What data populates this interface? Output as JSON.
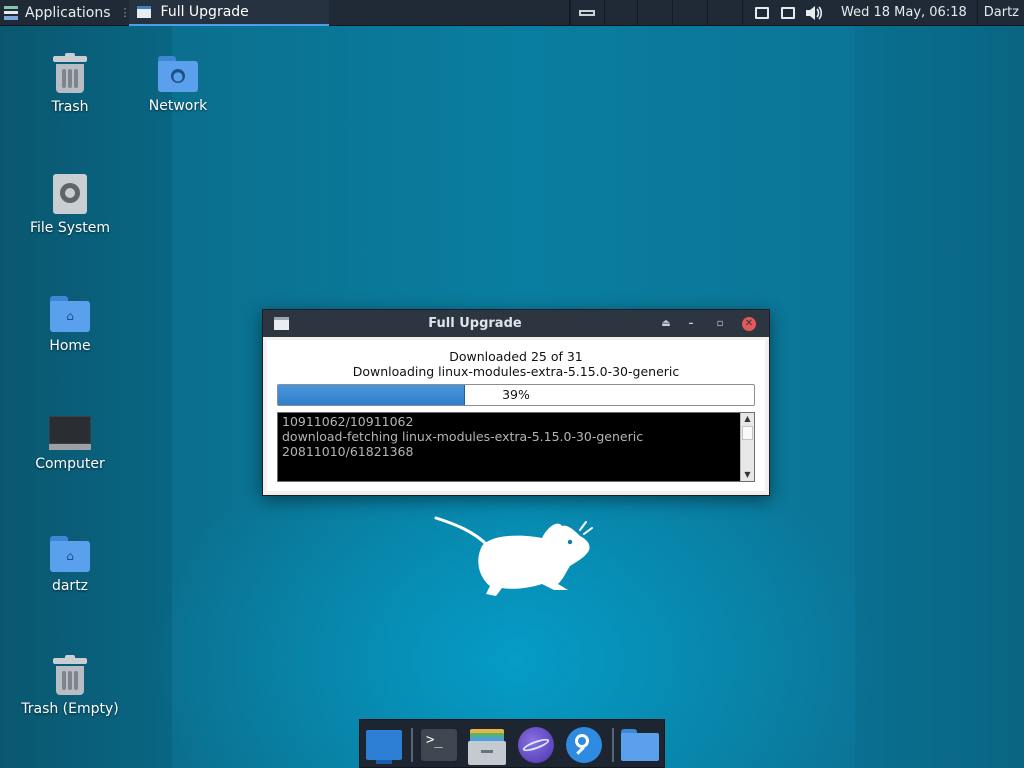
{
  "top_panel": {
    "applications_label": "Applications",
    "active_window_label": "Full Upgrade",
    "clock": "Wed 18 May, 06:18",
    "user": "Dartz"
  },
  "desktop_icons": [
    {
      "label": "Trash",
      "icon": "trash-icon"
    },
    {
      "label": "Network",
      "icon": "network-folder-icon"
    },
    {
      "label": "File System",
      "icon": "filesystem-icon"
    },
    {
      "label": "Home",
      "icon": "home-folder-icon"
    },
    {
      "label": "Computer",
      "icon": "computer-icon"
    },
    {
      "label": "dartz",
      "icon": "user-folder-icon"
    },
    {
      "label": "Trash (Empty)",
      "icon": "trash-icon"
    }
  ],
  "dialog": {
    "title": "Full Upgrade",
    "status_line1": "Downloaded 25 of 31",
    "status_line2": "Downloading linux-modules-extra-5.15.0-30-generic",
    "progress_label": "39%",
    "progress_fraction": 0.39,
    "log_lines": [
      "10911062/10911062",
      "download-fetching linux-modules-extra-5.15.0-30-generic",
      "20811010/61821368"
    ]
  },
  "dock": {
    "items": [
      "show-desktop-icon",
      "terminal-icon",
      "file-manager-icon",
      "web-browser-icon",
      "search-icon",
      "folder-icon"
    ]
  },
  "colors": {
    "desktop": "#0a7ea0",
    "panel": "#1f2a36",
    "progress": "#3a8ad4",
    "close": "#e05a5a"
  }
}
